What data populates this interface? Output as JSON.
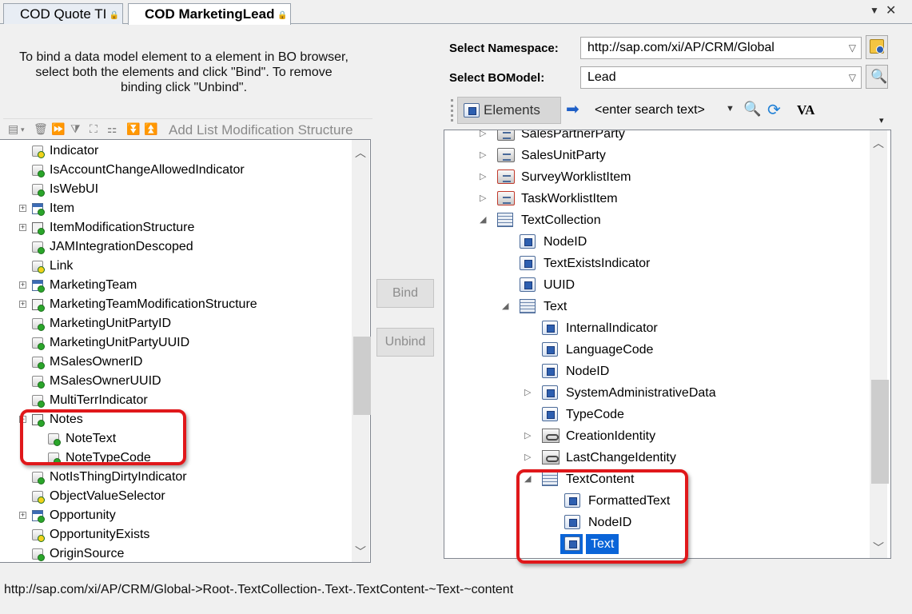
{
  "tabs": [
    {
      "label": "COD Quote TI"
    },
    {
      "label": "COD MarketingLead"
    }
  ],
  "instructions": {
    "line1": "To bind a data model element to a element in BO browser,",
    "line2": "select both the elements and click \"Bind\". To remove",
    "line3": "binding click \"Unbind\"."
  },
  "left_toolbar": {
    "add_label": "Add List Modification Structure"
  },
  "left_tree": [
    {
      "label": "Indicator",
      "icon": "field-icon"
    },
    {
      "label": "IsAccountChangeAllowedIndicator",
      "icon": "field-icon"
    },
    {
      "label": "IsWebUI",
      "icon": "field-icon"
    },
    {
      "label": "Item",
      "icon": "table-icon"
    },
    {
      "label": "ItemModificationStructure",
      "icon": "structure-icon"
    },
    {
      "label": "JAMIntegrationDescoped",
      "icon": "field-icon"
    },
    {
      "label": "Link",
      "icon": "field-icon"
    },
    {
      "label": "MarketingTeam",
      "icon": "table-icon"
    },
    {
      "label": "MarketingTeamModificationStructure",
      "icon": "structure-icon"
    },
    {
      "label": "MarketingUnitPartyID",
      "icon": "field-icon"
    },
    {
      "label": "MarketingUnitPartyUUID",
      "icon": "field-icon"
    },
    {
      "label": "MSalesOwnerID",
      "icon": "field-icon"
    },
    {
      "label": "MSalesOwnerUUID",
      "icon": "field-icon"
    },
    {
      "label": "MultiTerrIndicator",
      "icon": "field-icon"
    },
    {
      "label": "Notes",
      "icon": "structure-icon"
    },
    {
      "label": "NoteText",
      "icon": "field-icon"
    },
    {
      "label": "NoteTypeCode",
      "icon": "field-icon"
    },
    {
      "label": "NotIsThingDirtyIndicator",
      "icon": "field-icon"
    },
    {
      "label": "ObjectValueSelector",
      "icon": "field-icon"
    },
    {
      "label": "Opportunity",
      "icon": "table-icon"
    },
    {
      "label": "OpportunityExists",
      "icon": "field-icon"
    },
    {
      "label": "OriginSource",
      "icon": "field-icon"
    }
  ],
  "buttons": {
    "bind": "Bind",
    "unbind": "Unbind"
  },
  "namespace": {
    "label": "Select Namespace:",
    "value": "http://sap.com/xi/AP/CRM/Global"
  },
  "bomodel": {
    "label": "Select BOModel:",
    "value": "Lead"
  },
  "right_toolbar": {
    "elements_label": "Elements",
    "search_placeholder": "<enter search text>",
    "va_label": "VA"
  },
  "right_tree": [
    {
      "label": "SalesPartnerParty"
    },
    {
      "label": "SalesUnitParty"
    },
    {
      "label": "SurveyWorklistItem"
    },
    {
      "label": "TaskWorklistItem"
    },
    {
      "label": "TextCollection"
    },
    {
      "label": "NodeID"
    },
    {
      "label": "TextExistsIndicator"
    },
    {
      "label": "UUID"
    },
    {
      "label": "Text"
    },
    {
      "label": "InternalIndicator"
    },
    {
      "label": "LanguageCode"
    },
    {
      "label": "NodeID"
    },
    {
      "label": "SystemAdministrativeData"
    },
    {
      "label": "TypeCode"
    },
    {
      "label": "CreationIdentity"
    },
    {
      "label": "LastChangeIdentity"
    },
    {
      "label": "TextContent"
    },
    {
      "label": "FormattedText"
    },
    {
      "label": "NodeID"
    },
    {
      "label": "Text"
    }
  ],
  "status_path": "http://sap.com/xi/AP/CRM/Global->Root-.TextCollection-.Text-.TextContent-~Text-~content"
}
